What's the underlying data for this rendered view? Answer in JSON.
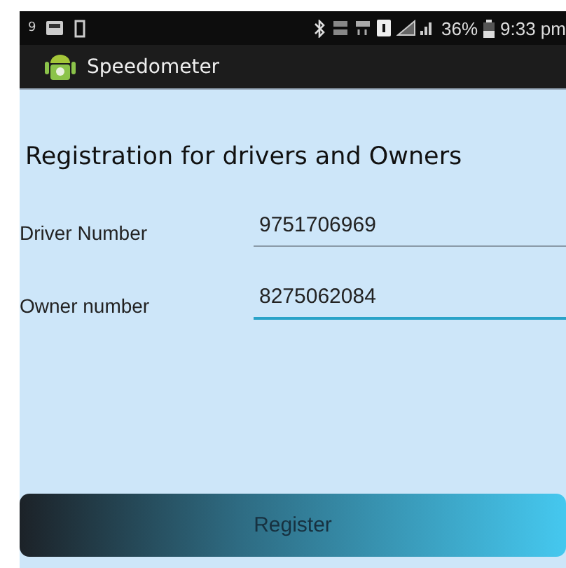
{
  "status_bar": {
    "speed": "9",
    "battery": "36%",
    "time": "9:33 pm"
  },
  "app_bar": {
    "title": "Speedometer"
  },
  "heading": "Registration for drivers and Owners",
  "fields": [
    {
      "label": "Driver Number",
      "value": "9751706969",
      "focused": false
    },
    {
      "label": "Owner number",
      "value": "8275062084",
      "focused": true
    }
  ],
  "button": "Register"
}
